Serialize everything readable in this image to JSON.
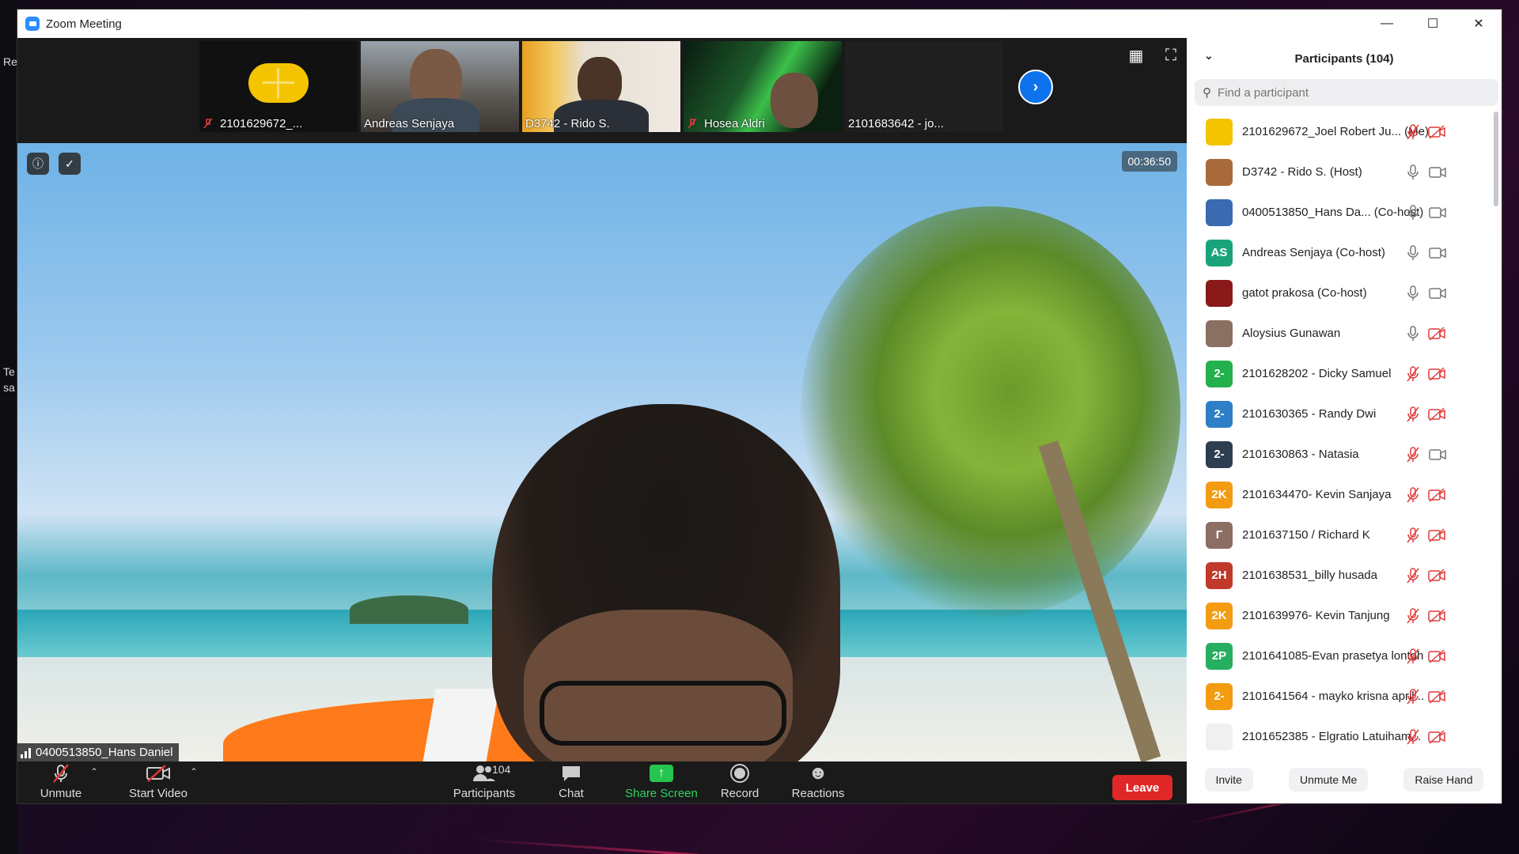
{
  "window": {
    "title": "Zoom Meeting"
  },
  "desktop_labels": [
    "Re",
    "Te",
    "sa"
  ],
  "thumbnails": [
    {
      "name": "2101629672_...",
      "muted": true,
      "avatar": "yellow-pill"
    },
    {
      "name": "Andreas Senjaya",
      "muted": false
    },
    {
      "name": "D3742 - Rido S.",
      "muted": false
    },
    {
      "name": "Hosea Aldri",
      "muted": true
    },
    {
      "name": "2101683642 - jo...",
      "muted": false
    }
  ],
  "main_video": {
    "timer": "00:36:50",
    "speaker_name": "0400513850_Hans Daniel"
  },
  "toolbar": {
    "unmute_label": "Unmute",
    "start_video_label": "Start Video",
    "participants_label": "Participants",
    "participants_count": "104",
    "chat_label": "Chat",
    "share_label": "Share Screen",
    "record_label": "Record",
    "reactions_label": "Reactions",
    "leave_label": "Leave"
  },
  "panel": {
    "title": "Participants (104)",
    "search_placeholder": "Find a participant",
    "participants": [
      {
        "name": "2101629672_Joel Robert Ju... (Me)",
        "avatar_text": "",
        "avatar_color": "#f5c400",
        "mic": "muted",
        "cam": "off"
      },
      {
        "name": "D3742 - Rido S. (Host)",
        "avatar_text": "",
        "avatar_color": "#a86a3a",
        "mic": "on",
        "cam": "on"
      },
      {
        "name": "0400513850_Hans Da... (Co-host)",
        "avatar_text": "",
        "avatar_color": "#3a6ab0",
        "mic": "on",
        "cam": "on"
      },
      {
        "name": "Andreas Senjaya (Co-host)",
        "avatar_text": "AS",
        "avatar_color": "#1aa37a",
        "mic": "on",
        "cam": "on"
      },
      {
        "name": "gatot prakosa (Co-host)",
        "avatar_text": "",
        "avatar_color": "#8a1a1a",
        "mic": "on",
        "cam": "on"
      },
      {
        "name": "Aloysius Gunawan",
        "avatar_text": "",
        "avatar_color": "#8a7060",
        "mic": "on",
        "cam": "off"
      },
      {
        "name": "2101628202 - Dicky Samuel",
        "avatar_text": "2-",
        "avatar_color": "#22b14c",
        "mic": "muted",
        "cam": "off"
      },
      {
        "name": "2101630365 - Randy Dwi",
        "avatar_text": "2-",
        "avatar_color": "#2e7fc7",
        "mic": "muted",
        "cam": "off"
      },
      {
        "name": "2101630863 - Natasia",
        "avatar_text": "2-",
        "avatar_color": "#2d3e50",
        "mic": "muted",
        "cam": "on"
      },
      {
        "name": "2101634470- Kevin Sanjaya",
        "avatar_text": "2K",
        "avatar_color": "#f39c12",
        "mic": "muted",
        "cam": "off"
      },
      {
        "name": "2101637150 / Richard K",
        "avatar_text": "Г",
        "avatar_color": "#8d6e63",
        "mic": "muted",
        "cam": "off"
      },
      {
        "name": "2101638531_billy husada",
        "avatar_text": "2H",
        "avatar_color": "#c0392b",
        "mic": "muted",
        "cam": "off"
      },
      {
        "name": "2101639976- Kevin Tanjung",
        "avatar_text": "2K",
        "avatar_color": "#f39c12",
        "mic": "muted",
        "cam": "off"
      },
      {
        "name": "2101641085-Evan prasetya lontoh",
        "avatar_text": "2P",
        "avatar_color": "#27ae60",
        "mic": "muted",
        "cam": "off"
      },
      {
        "name": "2101641564 - mayko krisna april...",
        "avatar_text": "2-",
        "avatar_color": "#f39c12",
        "mic": "muted",
        "cam": "off"
      },
      {
        "name": "2101652385 - Elgratio Latuiham...",
        "avatar_text": "",
        "avatar_color": "#f0f0f0",
        "mic": "muted",
        "cam": "off"
      }
    ],
    "footer": {
      "invite": "Invite",
      "unmute_me": "Unmute Me",
      "raise_hand": "Raise Hand"
    }
  },
  "colors": {
    "accent": "#0e72ed",
    "leave": "#e02828",
    "share": "#26c450",
    "muted": "#e03a3a"
  }
}
